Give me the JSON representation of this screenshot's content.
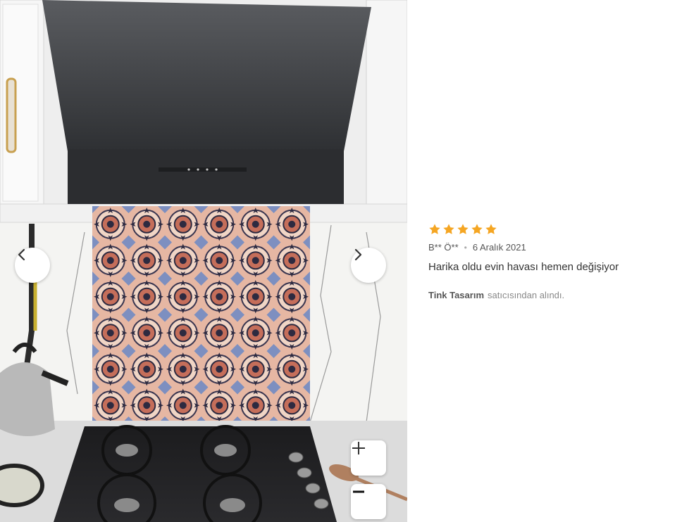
{
  "review": {
    "rating": 5,
    "rating_max": 5,
    "star_color": "#f5a623",
    "author": "B** Ö**",
    "date": "6 Aralık 2021",
    "comment": "Harika oldu evin havası hemen değişiyor",
    "seller_name": "Tink Tasarım",
    "seller_suffix": "satıcısından alındı."
  },
  "controls": {
    "prev_icon": "chevron-left-icon",
    "next_icon": "chevron-right-icon",
    "zoom_in_icon": "plus-icon",
    "zoom_out_icon": "minus-icon"
  }
}
